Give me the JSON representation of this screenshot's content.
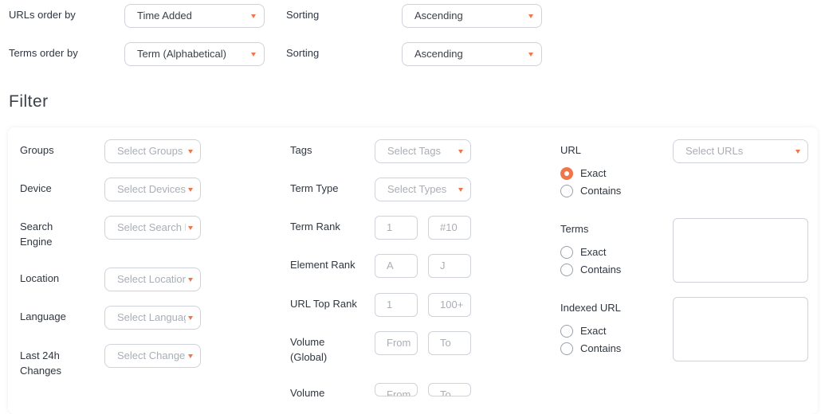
{
  "order": {
    "urls_label": "URLs order by",
    "urls_value": "Time Added",
    "urls_sorting_label": "Sorting",
    "urls_sorting_value": "Ascending",
    "terms_label": "Terms order by",
    "terms_value": "Term (Alphabetical)",
    "terms_sorting_label": "Sorting",
    "terms_sorting_value": "Ascending"
  },
  "filter": {
    "title": "Filter",
    "col1": {
      "groups_label": "Groups",
      "groups_ph": "Select Groups",
      "device_label": "Device",
      "device_ph": "Select Devices",
      "search_engine_label_1": "Search",
      "search_engine_label_2": "Engine",
      "search_engine_ph": "Select Search E",
      "location_label": "Location",
      "location_ph": "Select Locations",
      "language_label": "Language",
      "language_ph": "Select Languages",
      "changes_label_1": "Last 24h",
      "changes_label_2": "Changes",
      "changes_ph": "Select Changes"
    },
    "col2": {
      "tags_label": "Tags",
      "tags_ph": "Select Tags",
      "term_type_label": "Term Type",
      "term_type_ph": "Select Types",
      "term_rank_label": "Term Rank",
      "term_rank_from": "1",
      "term_rank_to": "#10",
      "element_rank_label": "Element Rank",
      "element_rank_from": "A",
      "element_rank_to": "J",
      "url_top_rank_label": "URL Top Rank",
      "url_top_rank_from": "1",
      "url_top_rank_to": "100+",
      "volume_global_label_1": "Volume",
      "volume_global_label_2": "(Global)",
      "volume_global_from": "From",
      "volume_global_to": "To",
      "volume2_label": "Volume",
      "volume2_from": "From",
      "volume2_to": "To"
    },
    "col3": {
      "url_label": "URL",
      "url_ph": "Select URLs",
      "url_exact": "Exact",
      "url_contains": "Contains",
      "terms_label": "Terms",
      "terms_exact": "Exact",
      "terms_contains": "Contains",
      "indexed_label": "Indexed URL",
      "indexed_exact": "Exact",
      "indexed_contains": "Contains"
    }
  },
  "colors": {
    "accent": "#f0764a",
    "border": "#cfd3d9",
    "placeholder": "#a9aeb6"
  }
}
